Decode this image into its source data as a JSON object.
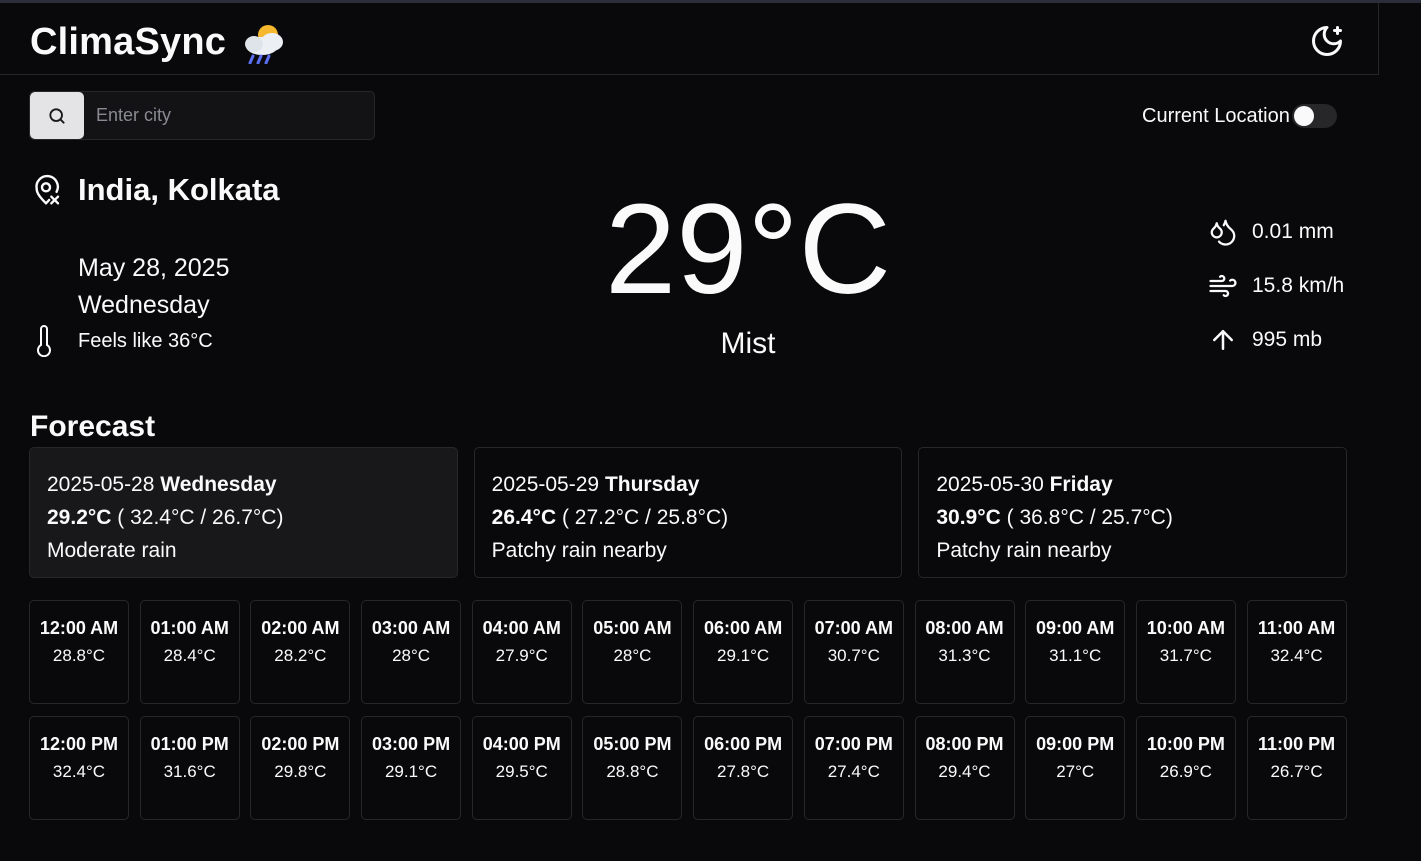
{
  "app": {
    "title": "ClimaSync",
    "accent": "#fafafa",
    "background": "#09090b",
    "border": "#27272a"
  },
  "search": {
    "placeholder": "Enter city",
    "value": ""
  },
  "location_toggle": {
    "label": "Current Location",
    "enabled": false
  },
  "current": {
    "place": "India, Kolkata",
    "date": "May 28, 2025",
    "weekday": "Wednesday",
    "feels_like": "Feels like 36°C",
    "temperature": "29°C",
    "condition": "Mist",
    "precip": "0.01 mm",
    "wind": "15.8 km/h",
    "pressure": "995 mb"
  },
  "forecast": {
    "title": "Forecast",
    "days": [
      {
        "date": "2025-05-28",
        "weekday": "Wednesday",
        "avg": "29.2°C",
        "range": " ( 32.4°C / 26.7°C)",
        "condition": "Moderate rain"
      },
      {
        "date": "2025-05-29",
        "weekday": "Thursday",
        "avg": "26.4°C",
        "range": " ( 27.2°C / 25.8°C)",
        "condition": "Patchy rain nearby"
      },
      {
        "date": "2025-05-30",
        "weekday": "Friday",
        "avg": "30.9°C",
        "range": " ( 36.8°C / 25.7°C)",
        "condition": "Patchy rain nearby"
      }
    ],
    "hours": [
      {
        "time": "12:00 AM",
        "temp": "28.8°C"
      },
      {
        "time": "01:00 AM",
        "temp": "28.4°C"
      },
      {
        "time": "02:00 AM",
        "temp": "28.2°C"
      },
      {
        "time": "03:00 AM",
        "temp": "28°C"
      },
      {
        "time": "04:00 AM",
        "temp": "27.9°C"
      },
      {
        "time": "05:00 AM",
        "temp": "28°C"
      },
      {
        "time": "06:00 AM",
        "temp": "29.1°C"
      },
      {
        "time": "07:00 AM",
        "temp": "30.7°C"
      },
      {
        "time": "08:00 AM",
        "temp": "31.3°C"
      },
      {
        "time": "09:00 AM",
        "temp": "31.1°C"
      },
      {
        "time": "10:00 AM",
        "temp": "31.7°C"
      },
      {
        "time": "11:00 AM",
        "temp": "32.4°C"
      },
      {
        "time": "12:00 PM",
        "temp": "32.4°C"
      },
      {
        "time": "01:00 PM",
        "temp": "31.6°C"
      },
      {
        "time": "02:00 PM",
        "temp": "29.8°C"
      },
      {
        "time": "03:00 PM",
        "temp": "29.1°C"
      },
      {
        "time": "04:00 PM",
        "temp": "29.5°C"
      },
      {
        "time": "05:00 PM",
        "temp": "28.8°C"
      },
      {
        "time": "06:00 PM",
        "temp": "27.8°C"
      },
      {
        "time": "07:00 PM",
        "temp": "27.4°C"
      },
      {
        "time": "08:00 PM",
        "temp": "29.4°C"
      },
      {
        "time": "09:00 PM",
        "temp": "27°C"
      },
      {
        "time": "10:00 PM",
        "temp": "26.9°C"
      },
      {
        "time": "11:00 PM",
        "temp": "26.7°C"
      }
    ]
  },
  "icons": {
    "brand": "sun-behind-rain-cloud-icon",
    "theme": "moon-sparkle-icon",
    "search": "search-icon",
    "place": "map-pin-icon",
    "feels": "thermometer-icon",
    "precip": "droplets-icon",
    "wind": "wind-icon",
    "pressure": "arrow-up-icon"
  }
}
